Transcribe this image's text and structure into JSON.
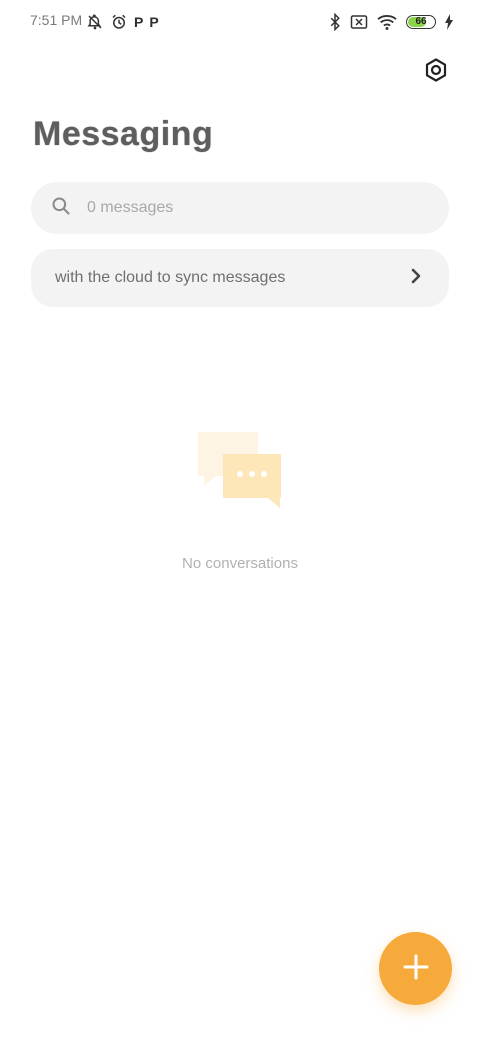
{
  "status_bar": {
    "time": "7:51 PM",
    "battery_level": "66",
    "battery_fraction": 0.66,
    "icons_left": [
      "notifications-off-icon",
      "alarm-icon",
      "p-icon",
      "p-icon"
    ],
    "icons_right": [
      "bluetooth-icon",
      "no-sim-icon",
      "wifi-icon",
      "battery-icon",
      "charging-icon"
    ]
  },
  "header": {
    "title": "Messaging",
    "settings_icon": "settings-icon"
  },
  "search": {
    "placeholder": "0 messages",
    "icon": "search-icon"
  },
  "cloud_banner": {
    "text": "with the cloud to sync messages",
    "chevron_icon": "chevron-right-icon"
  },
  "empty_state": {
    "icon": "conversation-icon",
    "text": "No conversations"
  },
  "fab": {
    "icon": "plus-icon"
  },
  "colors": {
    "accent": "#f6aa3b",
    "surface": "#f3f3f3",
    "text_muted": "#a9a9a9"
  }
}
